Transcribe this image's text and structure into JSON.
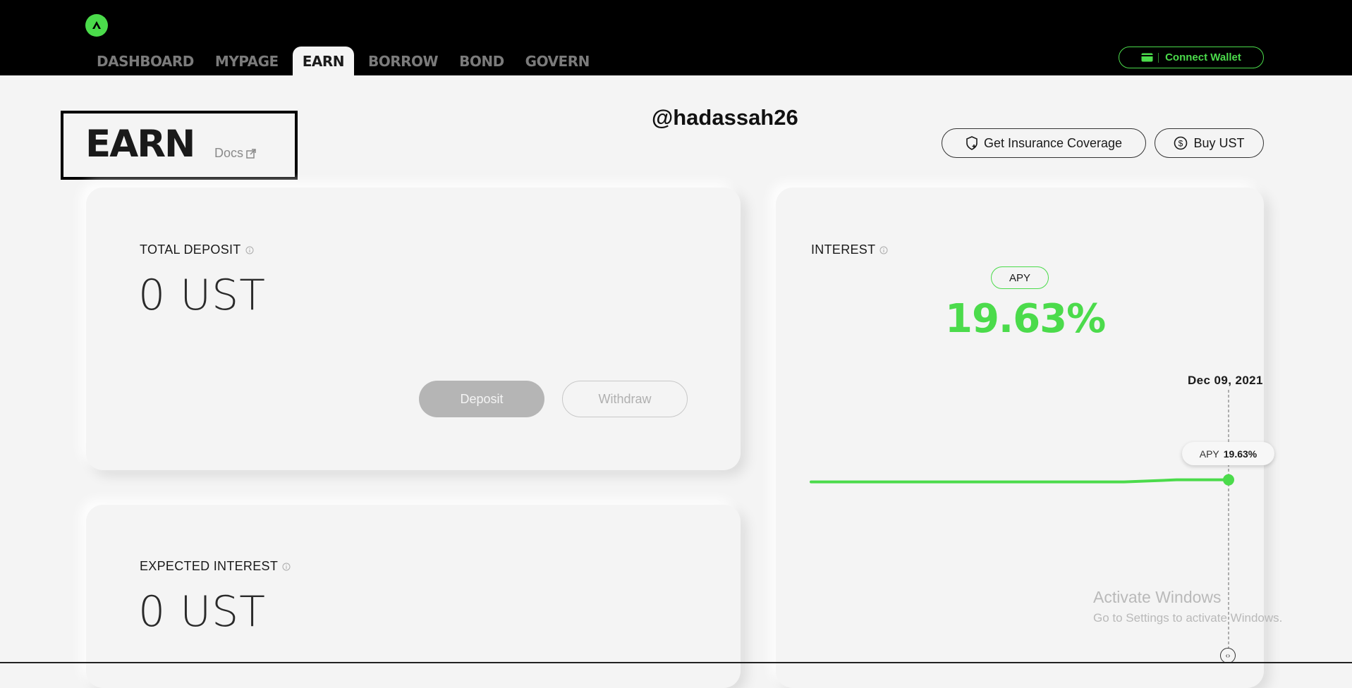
{
  "nav": {
    "tabs": [
      "DASHBOARD",
      "MYPAGE",
      "EARN",
      "BORROW",
      "BOND",
      "GOVERN"
    ],
    "active_tab": "EARN",
    "connect_wallet_label": "Connect Wallet"
  },
  "header": {
    "title": "EARN",
    "docs_label": "Docs",
    "username": "@hadassah26",
    "insurance_label": "Get Insurance Coverage",
    "buy_ust_label": "Buy UST"
  },
  "total_deposit": {
    "label": "TOTAL DEPOSIT",
    "value": "0 UST",
    "deposit_label": "Deposit",
    "withdraw_label": "Withdraw"
  },
  "expected_interest": {
    "label": "EXPECTED INTEREST",
    "value": "0 UST"
  },
  "interest": {
    "label": "INTEREST",
    "apy_tag": "APY",
    "apy_value": "19.63%",
    "chart_date": "Dec 09, 2021",
    "tooltip_label": "APY",
    "tooltip_value": "19.63%"
  },
  "chart_data": {
    "type": "line",
    "series": [
      {
        "values": [
          19.62,
          19.62,
          19.62,
          19.62,
          19.62,
          19.62,
          19.62,
          19.63,
          19.63
        ]
      }
    ],
    "highlight": {
      "date": "Dec 09, 2021",
      "value": 19.63
    }
  },
  "windows_watermark": {
    "title": "Activate Windows",
    "subtitle": "Go to Settings to activate Windows."
  },
  "colors": {
    "accent": "#4bdb4b",
    "topbar": "#000000",
    "background": "#f4f4f4"
  },
  "icons": [
    "anchor-logo-icon",
    "wallet-icon",
    "external-link-icon",
    "shield-icon",
    "dollar-circle-icon",
    "info-icon",
    "chart-handle-icon"
  ]
}
